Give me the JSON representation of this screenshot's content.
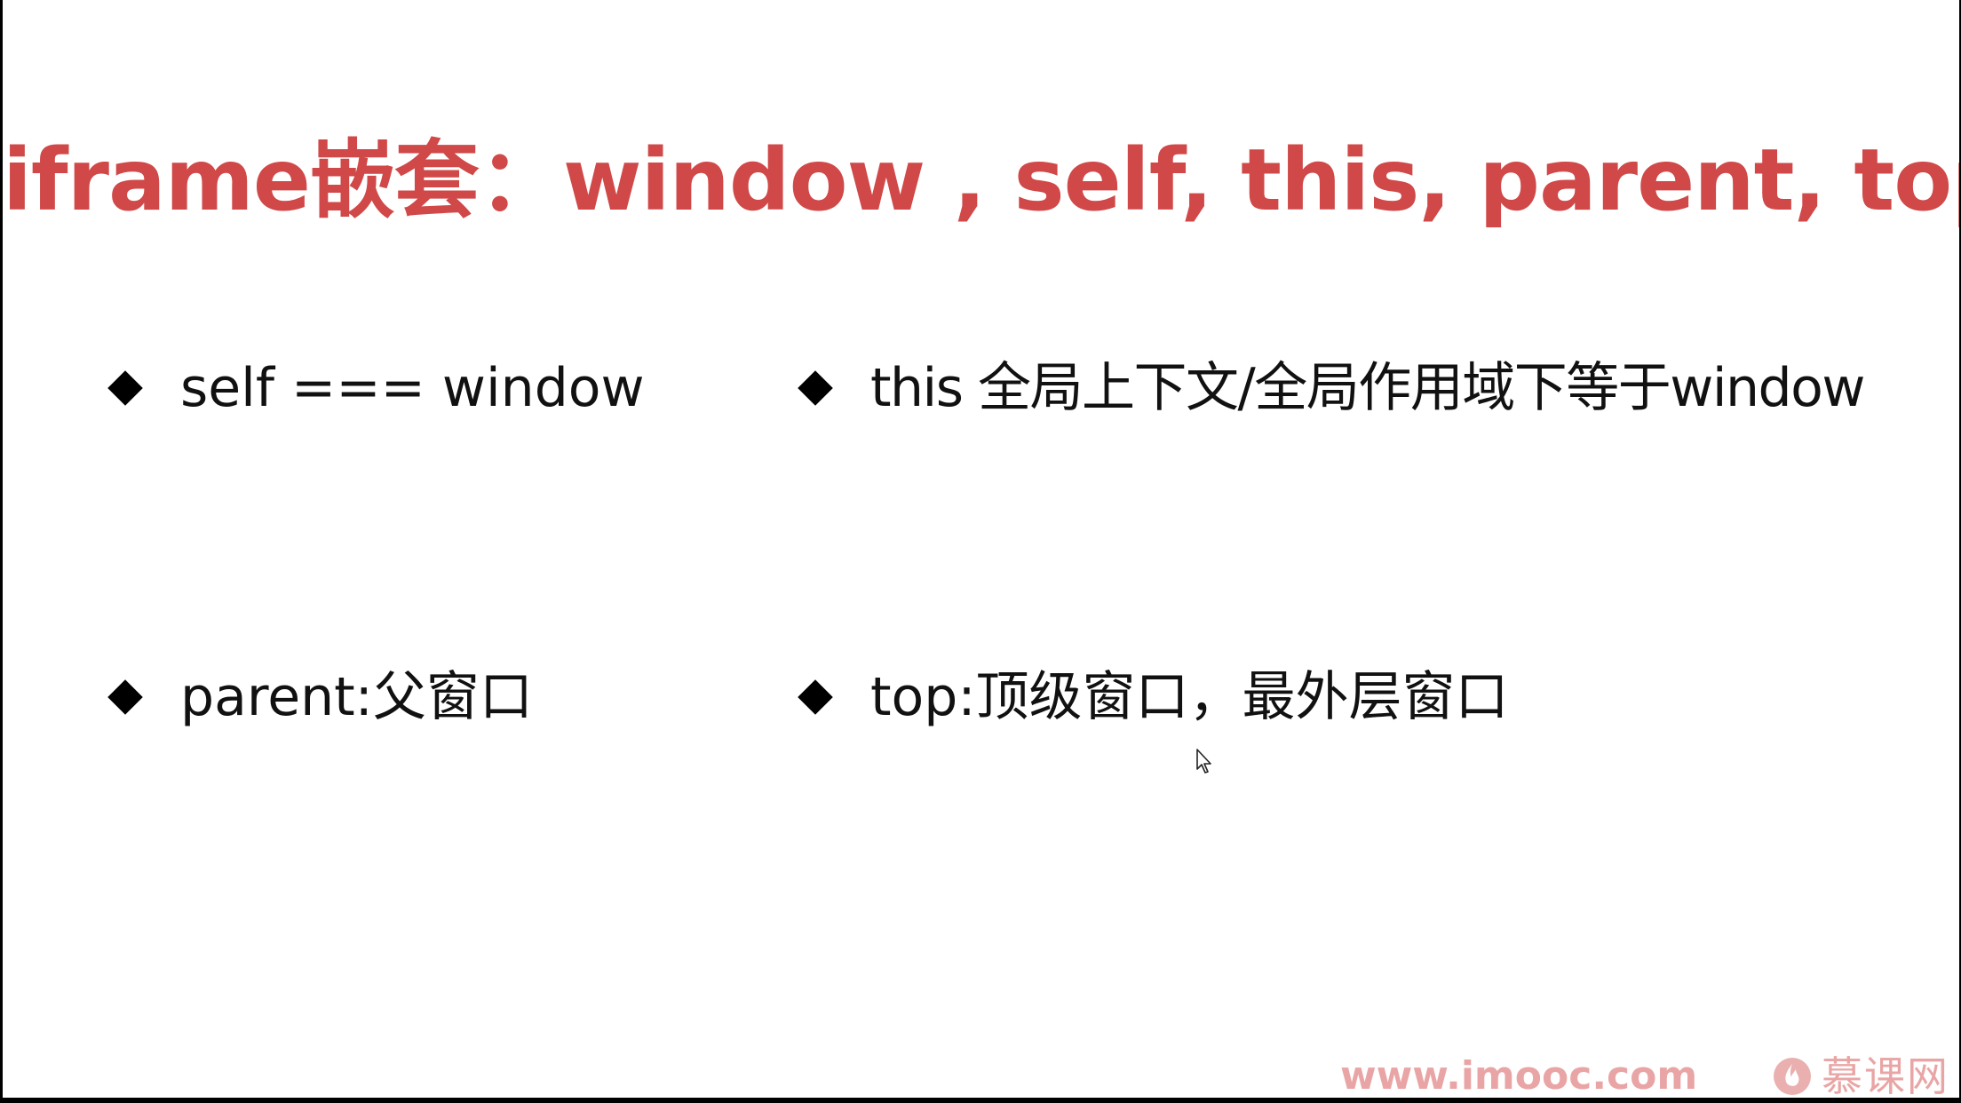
{
  "slide": {
    "title": "iframe嵌套：window , self, this, parent, top",
    "bullets": [
      {
        "text": "self === window"
      },
      {
        "text": "this 全局上下文/全局作用域下等于window"
      },
      {
        "text": "parent:父窗口"
      },
      {
        "text": "top:顶级窗口，最外层窗口"
      }
    ],
    "watermark": "www.imooc.com",
    "brand": "慕课网"
  },
  "icons": {
    "bullet": "diamond-bullet-icon",
    "cursor": "mouse-pointer-icon",
    "logo": "imooc-flame-icon"
  },
  "colors": {
    "title": "#d04848",
    "text": "#111111",
    "watermark": "#e9a5a5",
    "background": "#ffffff",
    "frame": "#000000"
  }
}
